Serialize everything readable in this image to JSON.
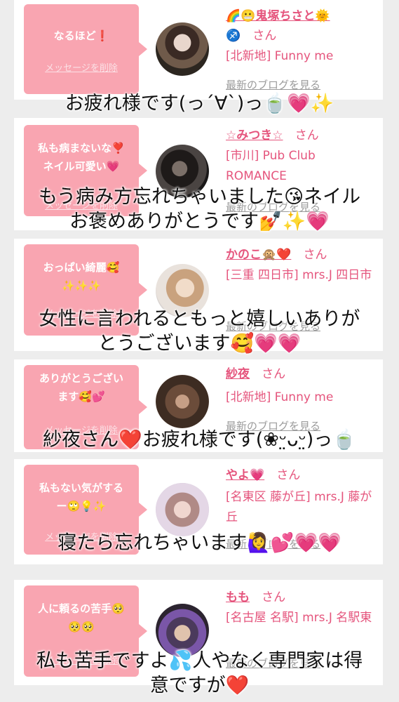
{
  "delete_label": "メッセージを削除",
  "san_label": "さん",
  "blog_label": "最新のブログを見る",
  "cards": [
    {
      "message": "なるほど❗️",
      "name": "🌈😬鬼塚ちさと🌞",
      "name2": "♐️",
      "shop": "[北新地] Funny me",
      "overlay": "お疲れ様です(っ´∀`)っ🍵💗✨"
    },
    {
      "message": "私も病まないな❣️\nネイル可愛い💗",
      "name": "☆みつき☆",
      "shop": "[市川] Pub Club ROMANCE",
      "overlay": "もう病み方忘れちゃいました😘ネイル\nお褒めありがとうです💅✨💗"
    },
    {
      "message": "おっぱい綺麗🥰\n✨✨✨",
      "name": "かのこ🙊❤️",
      "shop": "[三重 四日市] mrs.J 四日市",
      "overlay": "女性に言われるともっと嬉しいありが\nとうございます🥰💗💗"
    },
    {
      "message": "ありがとうござい\nます🥰💕",
      "name": "紗夜",
      "shop": "[北新地] Funny me",
      "overlay": "紗夜さん❤️お疲れ様です(❀ᵕ̤ᴗᵕ̤)っ🍵"
    },
    {
      "message": "私もない気がする\nー🙄💡✨",
      "name": "やよ💗",
      "shop": "[名東区 藤が丘] mrs.J 藤が丘",
      "overlay": "寝たら忘れちゃいます🙋‍♀️💕💗💗"
    },
    {
      "message": "人に頼るの苦手🥺\n🥺🥺",
      "name": "もも",
      "shop": "[名古屋 名駅] mrs.J 名駅東",
      "overlay": "私も苦手ですよ💦人やなく専門家は得\n意ですが❤️"
    }
  ]
}
